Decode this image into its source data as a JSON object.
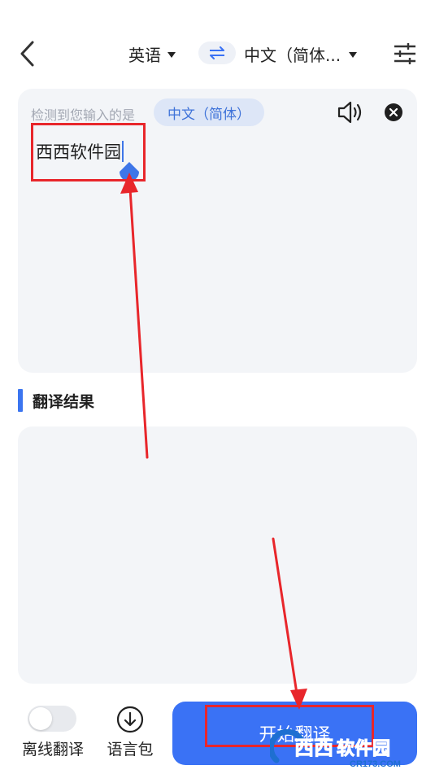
{
  "topbar": {
    "source_language": "英语",
    "target_language": "中文（简体..."
  },
  "input_panel": {
    "detect_label": "检测到您输入的是",
    "detected_language": "中文（简体）",
    "text": "西西软件园"
  },
  "result": {
    "title": "翻译结果",
    "text": ""
  },
  "bottom": {
    "offline_label": "离线翻译",
    "offline_enabled": false,
    "langpack_label": "语言包",
    "start_button": "开始翻译"
  },
  "watermark": {
    "brand": "西西软件园",
    "site": "CR173.COM"
  },
  "colors": {
    "accent": "#3a72f5",
    "panel_bg": "#f3f5f8",
    "chip_bg": "#dde6f7",
    "annotation": "#e8262b"
  },
  "icons": [
    "back-arrow-icon",
    "caret-down-icon",
    "swap-arrows-icon",
    "sliders-icon",
    "speaker-icon",
    "close-circle-icon",
    "cursor-handle-icon",
    "download-circle-icon"
  ]
}
